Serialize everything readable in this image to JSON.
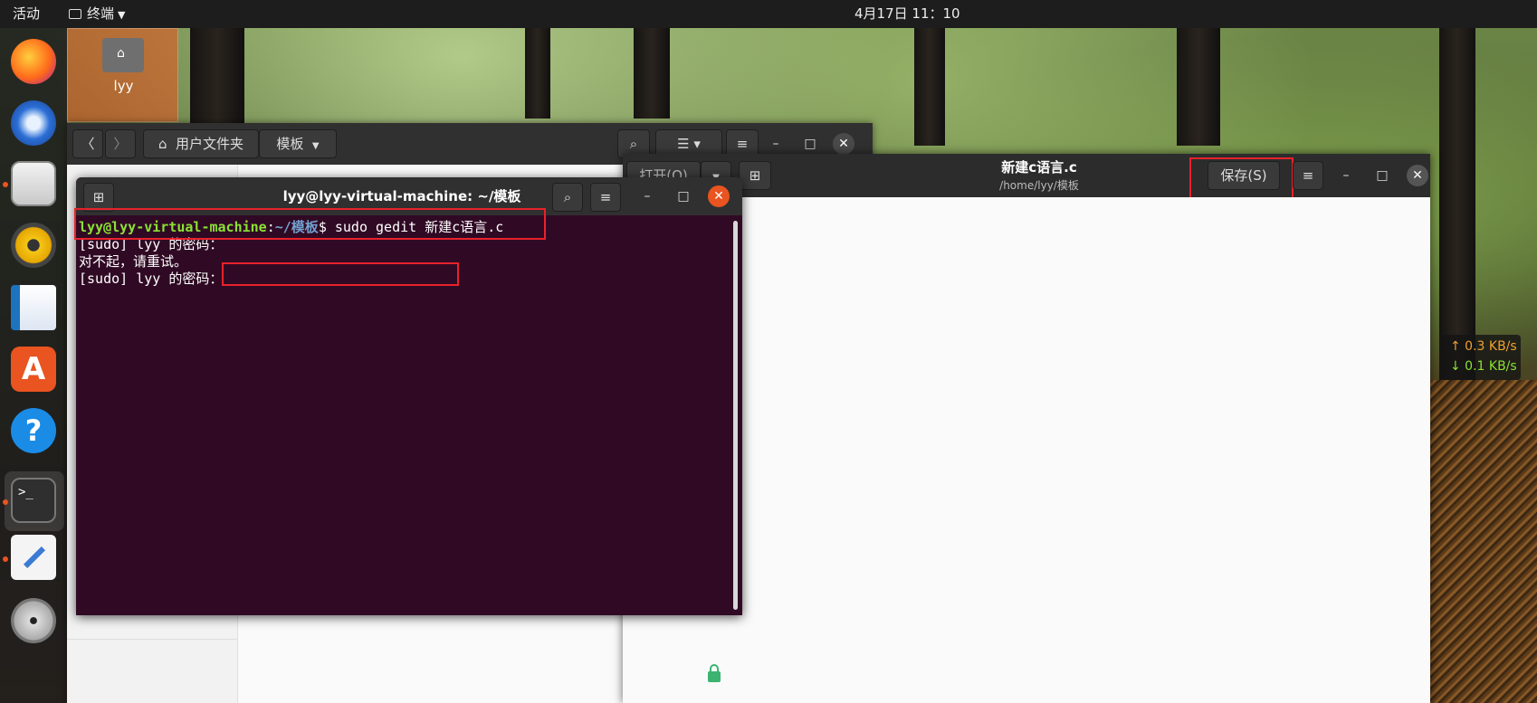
{
  "topbar": {
    "activities": "活动",
    "app_menu": "终端",
    "clock": "4月17日  11：10"
  },
  "desktop": {
    "home_label": "lyy"
  },
  "files": {
    "path_home": "用户文件夹",
    "path_current": "模板"
  },
  "terminal": {
    "title": "lyy@lyy-virtual-machine: ~/模板",
    "prompt_user": "lyy@lyy-virtual-machine",
    "prompt_sep": ":",
    "prompt_path": "~/模板",
    "prompt_dollar": "$ sudo gedit 新建c语言.c",
    "line2": "[sudo] lyy 的密码：",
    "line3": "对不起，请重试。",
    "line4": "[sudo] lyy 的密码："
  },
  "gedit": {
    "open_label": "打开(O)",
    "title": "新建c语言.c",
    "subtitle": "/home/lyy/模板",
    "save_label": "保存(S)"
  },
  "netspeed": {
    "up": "↑ 0.3 KB/s",
    "down": "↓ 0.1 KB/s"
  },
  "dock": {
    "apps": [
      "firefox",
      "thunderbird",
      "files",
      "rhythmbox",
      "libreoffice-writer",
      "software-center",
      "help",
      "terminal",
      "text-editor",
      "dvd"
    ]
  },
  "colors": {
    "terminal_bg": "#300a24",
    "prompt_user": "#8ae234",
    "prompt_path": "#729fcf",
    "accent": "#e95420",
    "highlight": "#e8222b"
  }
}
